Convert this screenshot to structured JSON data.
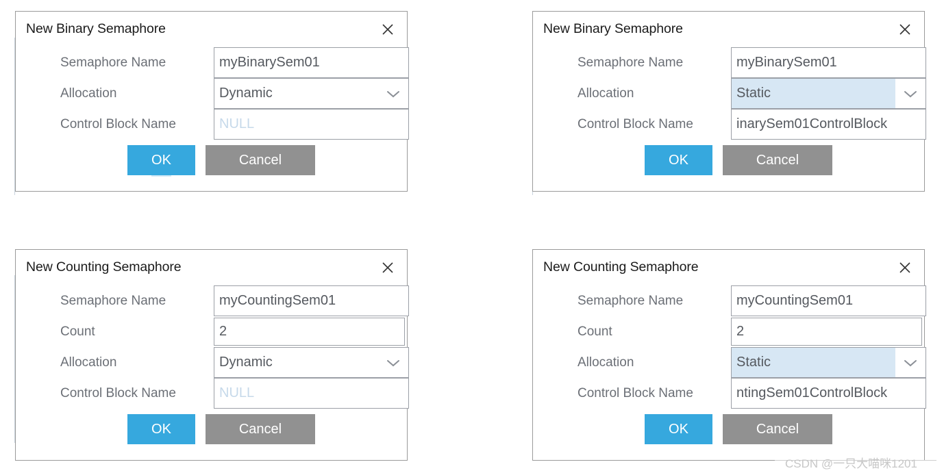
{
  "background": {
    "page_color": "#ffffff",
    "accent_color": "#36a8de",
    "cancel_color": "#919191",
    "select_highlight_color": "#d7e7f4",
    "label_color": "#6b6f76",
    "value_color": "#55595f",
    "placeholder_color": "#c6d9ea"
  },
  "dialogs": [
    {
      "id": "binary-dynamic",
      "title": "New Binary Semaphore",
      "close_icon": "close-icon",
      "rows": [
        {
          "label": "Semaphore Name",
          "type": "text",
          "value": "myBinarySem01",
          "is_placeholder": false
        },
        {
          "label": "Allocation",
          "type": "select",
          "value": "Dynamic",
          "highlight": false,
          "icon": "chevron-down-icon"
        },
        {
          "label": "Control Block Name",
          "type": "text",
          "value": "NULL",
          "is_placeholder": true
        }
      ],
      "buttons": {
        "ok": "OK",
        "cancel": "Cancel",
        "ok_underline": true
      }
    },
    {
      "id": "binary-static",
      "title": "New Binary Semaphore",
      "close_icon": "close-icon",
      "rows": [
        {
          "label": "Semaphore Name",
          "type": "text",
          "value": "myBinarySem01",
          "is_placeholder": false
        },
        {
          "label": "Allocation",
          "type": "select",
          "value": "Static",
          "highlight": true,
          "icon": "chevron-down-icon"
        },
        {
          "label": "Control Block Name",
          "type": "text",
          "value": "inarySem01ControlBlock",
          "is_placeholder": false
        }
      ],
      "buttons": {
        "ok": "OK",
        "cancel": "Cancel",
        "ok_underline": false
      }
    },
    {
      "id": "counting-dynamic",
      "title": "New Counting Semaphore",
      "close_icon": "close-icon",
      "rows": [
        {
          "label": "Semaphore Name",
          "type": "text",
          "value": "myCountingSem01",
          "is_placeholder": false
        },
        {
          "label": "Count",
          "type": "spinner",
          "value": "2",
          "is_placeholder": false
        },
        {
          "label": "Allocation",
          "type": "select",
          "value": "Dynamic",
          "highlight": false,
          "icon": "chevron-down-icon"
        },
        {
          "label": "Control Block Name",
          "type": "text",
          "value": "NULL",
          "is_placeholder": true
        }
      ],
      "buttons": {
        "ok": "OK",
        "cancel": "Cancel",
        "ok_underline": false
      }
    },
    {
      "id": "counting-static",
      "title": "New Counting Semaphore",
      "close_icon": "close-icon",
      "rows": [
        {
          "label": "Semaphore Name",
          "type": "text",
          "value": "myCountingSem01",
          "is_placeholder": false
        },
        {
          "label": "Count",
          "type": "spinner",
          "value": "2",
          "is_placeholder": false
        },
        {
          "label": "Allocation",
          "type": "select",
          "value": "Static",
          "highlight": true,
          "icon": "chevron-down-icon"
        },
        {
          "label": "Control Block Name",
          "type": "text",
          "value": "ntingSem01ControlBlock",
          "is_placeholder": false
        }
      ],
      "buttons": {
        "ok": "OK",
        "cancel": "Cancel",
        "ok_underline": false
      }
    }
  ],
  "watermark": {
    "text": "CSDN @一只大喵咪1201"
  }
}
